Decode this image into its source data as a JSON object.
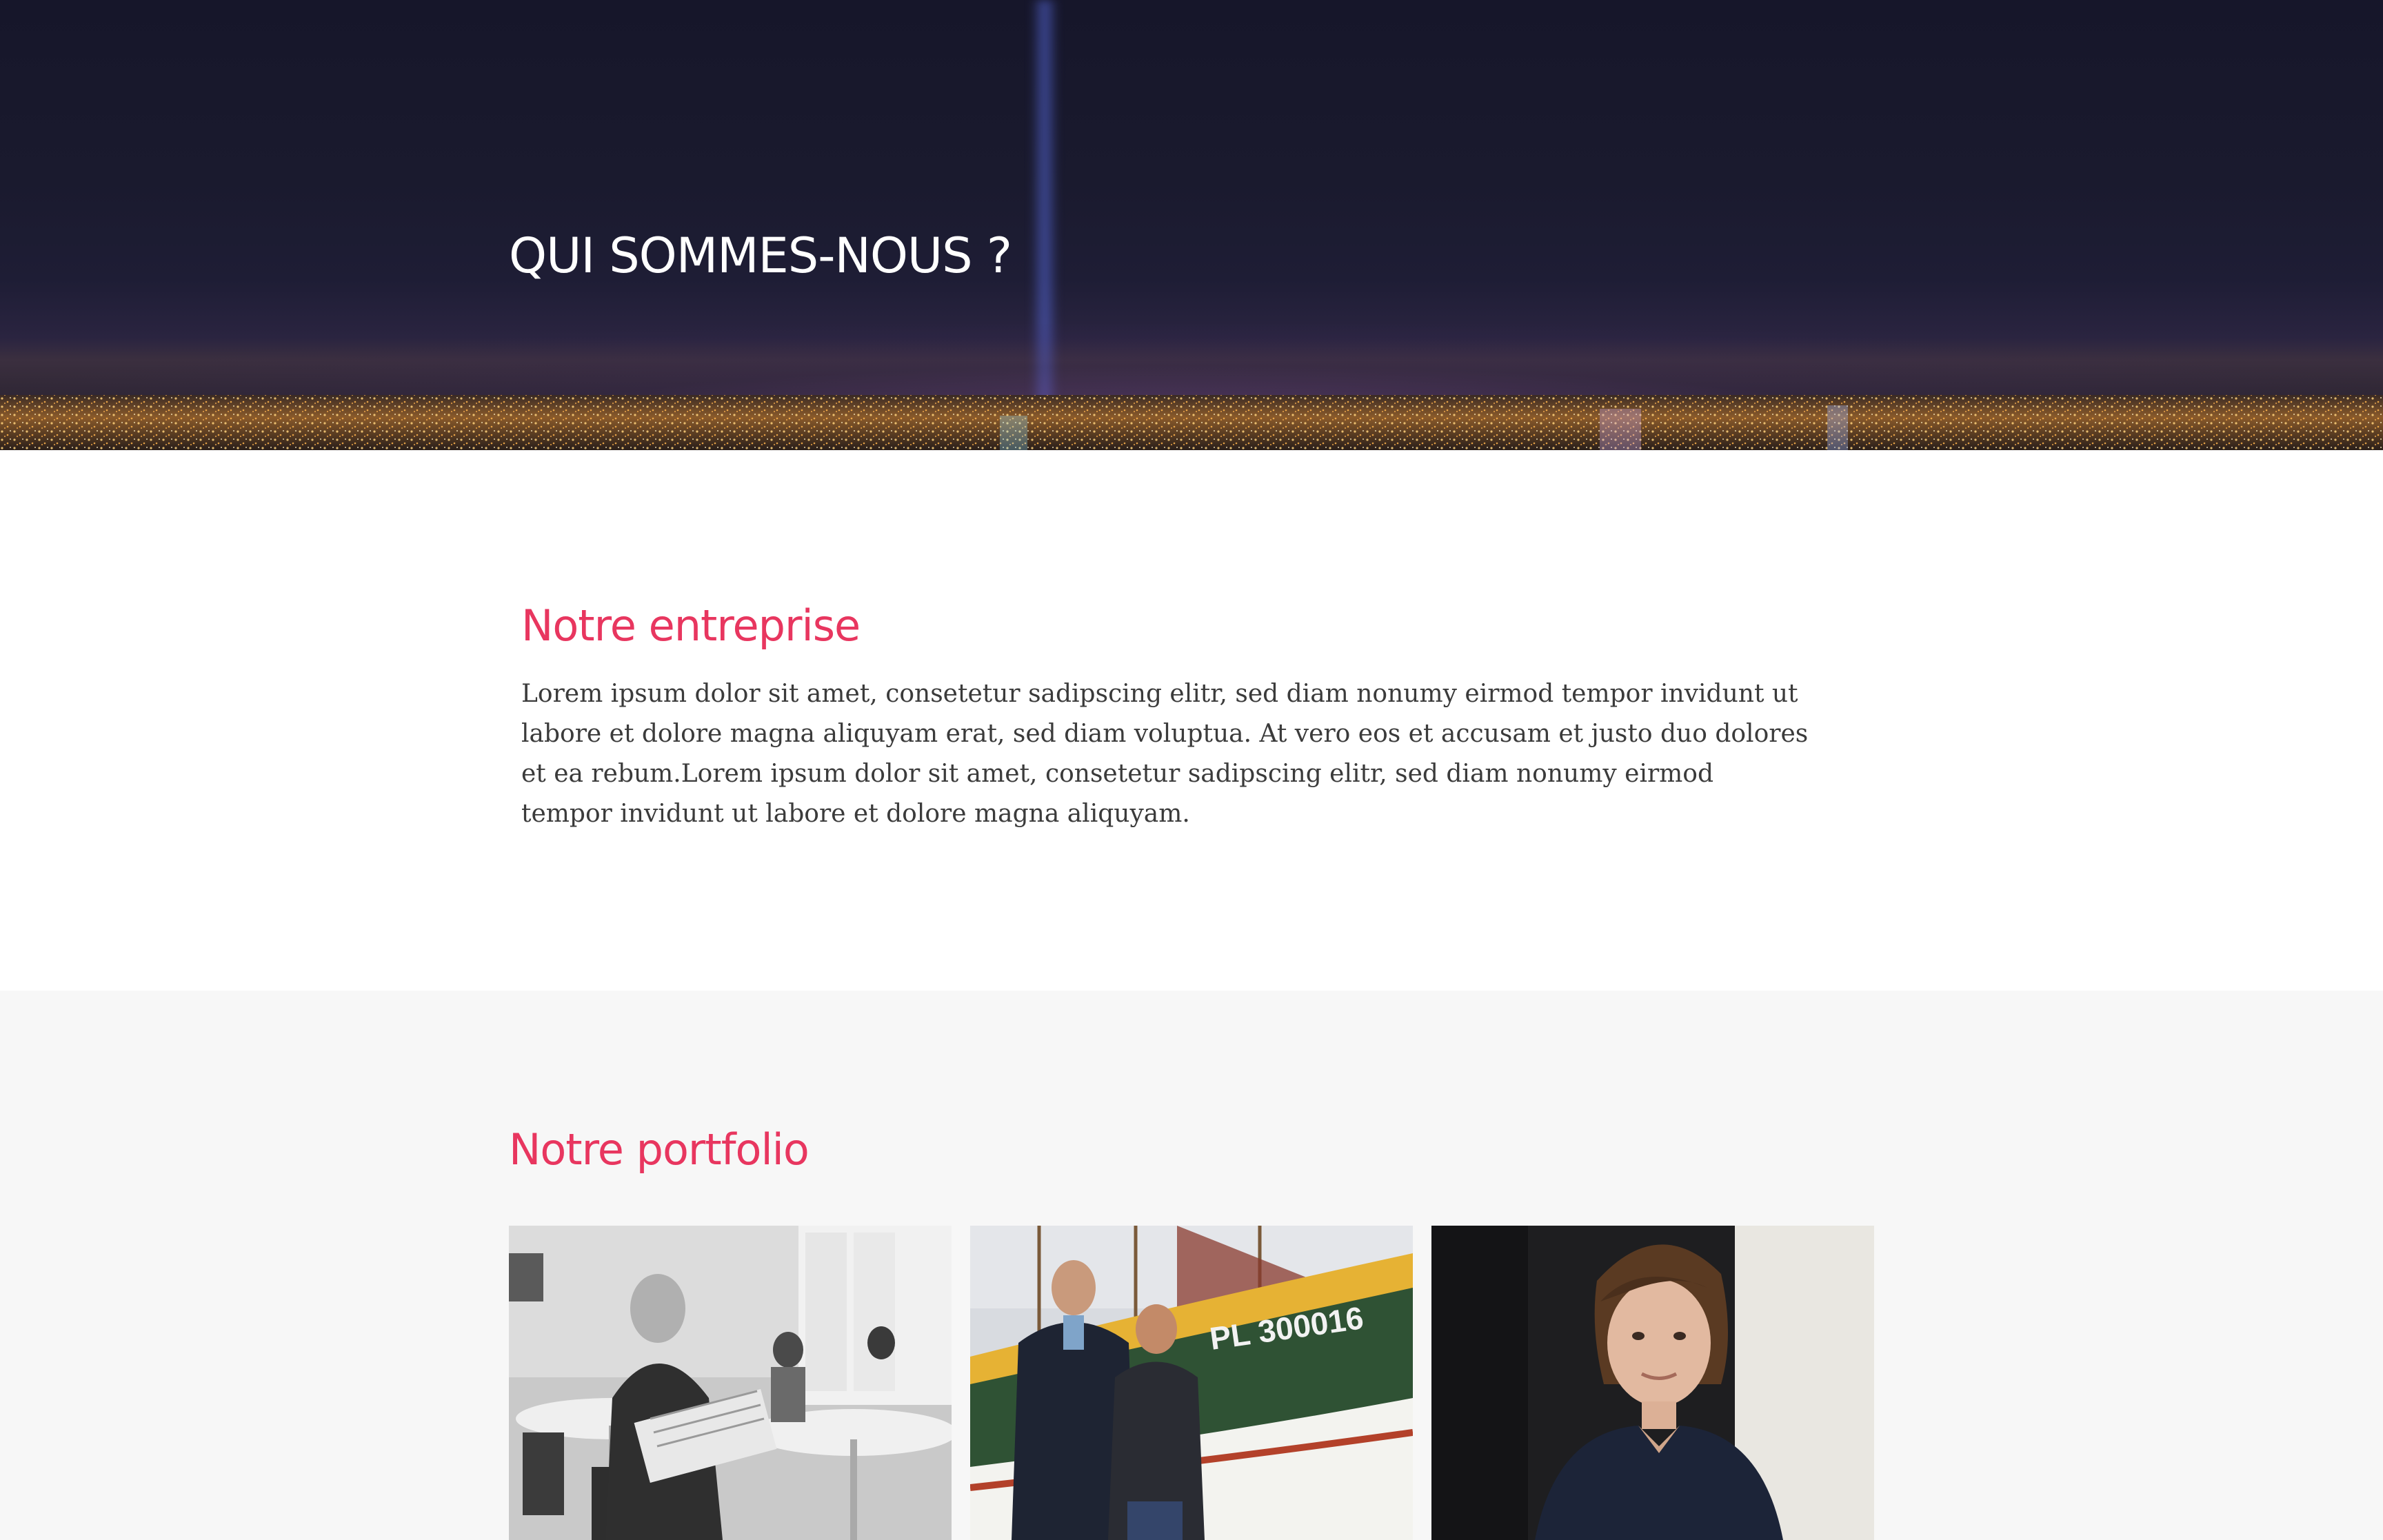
{
  "hero": {
    "title": "QUI SOMMES-NOUS ?"
  },
  "about": {
    "heading": "Notre entreprise",
    "text": "Lorem ipsum dolor sit amet, consetetur sadipscing elitr, sed diam nonumy eirmod tempor invidunt ut labore et dolore magna aliquyam erat, sed diam voluptua. At vero eos et accusam et justo duo dolores et ea rebum.Lorem ipsum dolor sit amet, consetetur sadipscing elitr, sed diam nonumy eirmod tempor invidunt ut labore et dolore magna aliquyam."
  },
  "portfolio": {
    "heading": "Notre portfolio",
    "items": [
      {
        "alt": ""
      },
      {
        "boat_label": "PL 300016"
      },
      {
        "alt": ""
      }
    ]
  },
  "colors": {
    "accent": "#e8365f",
    "hero_bg": "#1a1a2e",
    "section_alt_bg": "#f7f7f7",
    "body_text": "#3b3b3b"
  }
}
